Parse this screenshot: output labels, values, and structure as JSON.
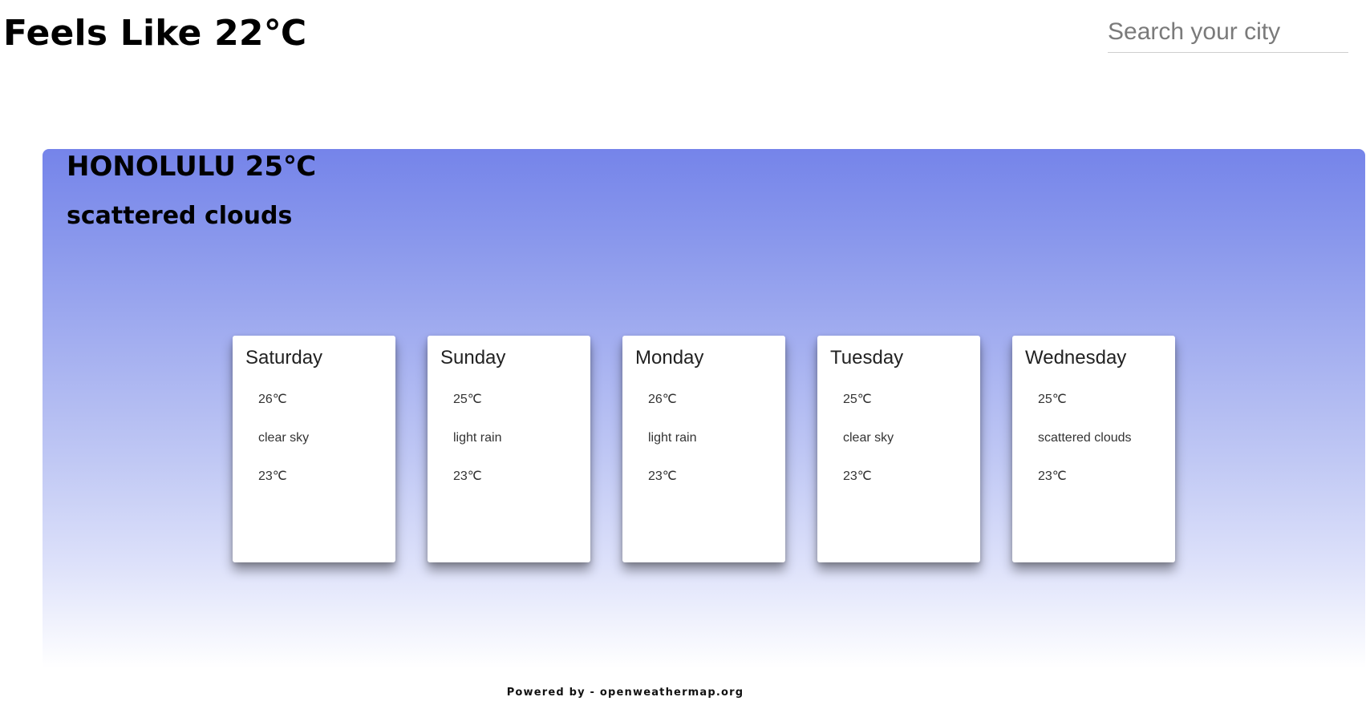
{
  "header": {
    "feels_like": "Feels Like 22℃"
  },
  "search": {
    "placeholder": "Search your city",
    "value": ""
  },
  "current": {
    "city_title": "HONOLULU 25℃",
    "condition": "scattered clouds"
  },
  "forecast": [
    {
      "day": "Saturday",
      "high": "26℃",
      "condition": "clear sky",
      "low": "23℃"
    },
    {
      "day": "Sunday",
      "high": "25℃",
      "condition": "light rain",
      "low": "23℃"
    },
    {
      "day": "Monday",
      "high": "26℃",
      "condition": "light rain",
      "low": "23℃"
    },
    {
      "day": "Tuesday",
      "high": "25℃",
      "condition": "clear sky",
      "low": "23℃"
    },
    {
      "day": "Wednesday",
      "high": "25℃",
      "condition": "scattered clouds",
      "low": "23℃"
    }
  ],
  "footer": {
    "text": "Powered by - openweathermap.org"
  },
  "colors": {
    "panel_top": "#7584ea",
    "panel_bottom": "#ffffff",
    "card_bg": "#ffffff"
  }
}
